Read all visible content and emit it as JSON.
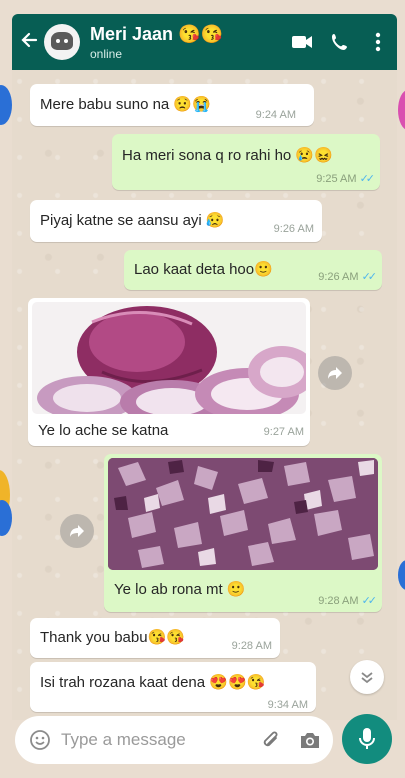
{
  "header": {
    "contact_name": "Meri Jaan 😘😘",
    "status": "online",
    "icons": [
      "back-arrow-icon",
      "video-call-icon",
      "voice-call-icon",
      "more-options-icon"
    ]
  },
  "messages": [
    {
      "direction": "in",
      "text": "Mere babu suno na 😟😭",
      "time": "9:24 AM"
    },
    {
      "direction": "out",
      "text": "Ha meri sona q ro rahi ho 😢😖",
      "time": "9:25 AM",
      "ticks": "✓✓"
    },
    {
      "direction": "in",
      "text": "Piyaj katne se aansu ayi 😥",
      "time": "9:26 AM"
    },
    {
      "direction": "out",
      "text": "Lao kaat deta hoo🙂",
      "time": "9:26 AM",
      "ticks": "✓✓"
    },
    {
      "direction": "in",
      "type": "image",
      "caption": "Ye lo ache se katna",
      "time": "9:27 AM",
      "image": "whole-onion-photo"
    },
    {
      "direction": "out",
      "type": "image",
      "caption": "Ye lo ab rona mt 🙂",
      "time": "9:28 AM",
      "ticks": "✓✓",
      "image": "chopped-onion-photo"
    },
    {
      "direction": "in",
      "text": "Thank you babu😘😘",
      "time": "9:28 AM"
    },
    {
      "direction": "in",
      "text": "Isi trah rozana kaat dena 😍😍😘",
      "time": "9:34 AM"
    }
  ],
  "composer": {
    "placeholder": "Type a message",
    "icons": [
      "emoji-icon",
      "attach-icon",
      "camera-icon",
      "mic-icon"
    ]
  },
  "colors": {
    "header": "#075e54",
    "outgoing_bubble": "#dcf8c6",
    "incoming_bubble": "#ffffff",
    "mic_button": "#128c7e",
    "read_ticks": "#4fb6ec"
  }
}
